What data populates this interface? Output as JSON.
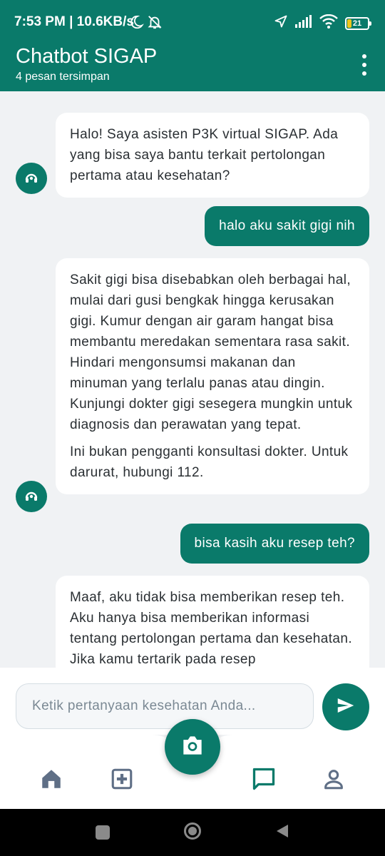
{
  "status_bar": {
    "time_text": "7:53 PM | 10.6KB/s",
    "battery_level": "21",
    "icons": [
      "moon-icon",
      "bell-off-icon",
      "location-icon",
      "signal-icon",
      "wifi-icon",
      "battery-icon"
    ]
  },
  "header": {
    "title": "Chatbot SIGAP",
    "subtitle": "4 pesan tersimpan",
    "menu_icon": "more-vertical-icon"
  },
  "messages": [
    {
      "sender": "bot",
      "paragraphs": [
        "Halo! Saya asisten P3K virtual SIGAP. Ada yang bisa saya bantu terkait pertolongan pertama atau kesehatan?"
      ]
    },
    {
      "sender": "user",
      "text": "halo aku sakit gigi nih"
    },
    {
      "sender": "bot",
      "paragraphs": [
        "Sakit gigi bisa disebabkan oleh berbagai hal, mulai dari gusi bengkak hingga kerusakan gigi.  Kumur dengan air garam hangat bisa membantu meredakan sementara rasa sakit.  Hindari mengonsumsi makanan dan minuman yang terlalu panas atau dingin. Kunjungi dokter gigi sesegera mungkin untuk diagnosis dan perawatan yang tepat.",
        "Ini bukan pengganti konsultasi dokter. Untuk darurat, hubungi 112."
      ]
    },
    {
      "sender": "user",
      "text": "bisa kasih aku resep teh?"
    },
    {
      "sender": "bot",
      "paragraphs": [
        "Maaf, aku tidak bisa memberikan resep teh. Aku hanya bisa memberikan informasi tentang pertolongan pertama dan kesehatan.  Jika kamu tertarik pada resep"
      ]
    }
  ],
  "input": {
    "placeholder": "Ketik pertanyaan kesehatan Anda...",
    "value": ""
  },
  "bottom_nav": {
    "items": [
      "home-icon",
      "first-aid-icon",
      "camera-icon",
      "chat-icon",
      "profile-icon"
    ],
    "active": "chat-icon"
  },
  "colors": {
    "primary": "#0a7a6a",
    "background": "#f0f2f4",
    "nav_inactive": "#5f6f86"
  }
}
